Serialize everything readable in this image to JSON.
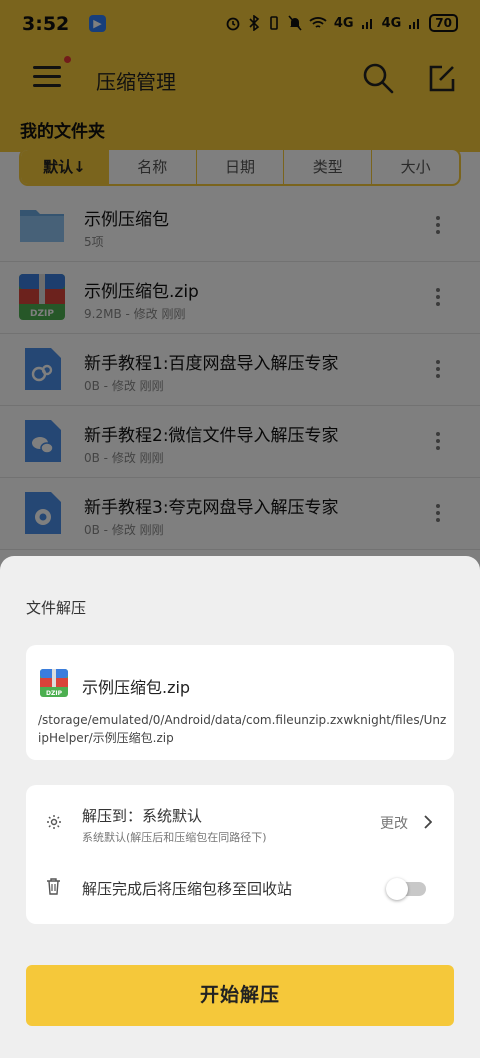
{
  "status_bar": {
    "time": "3:52",
    "app_badge": "▶",
    "network_1": "4G",
    "network_2": "4G",
    "battery": "70"
  },
  "app_bar": {
    "title": "压缩管理",
    "search_icon": "search-icon",
    "edit_icon": "edit-icon"
  },
  "section": {
    "title": "我的文件夹"
  },
  "sort_tabs": [
    {
      "label": "默认↓",
      "active": true
    },
    {
      "label": "名称",
      "active": false
    },
    {
      "label": "日期",
      "active": false
    },
    {
      "label": "类型",
      "active": false
    },
    {
      "label": "大小",
      "active": false
    }
  ],
  "files": [
    {
      "name": "示例压缩包",
      "meta": "5项",
      "icon": "folder-icon"
    },
    {
      "name": "示例压缩包.zip",
      "meta": "9.2MB - 修改 刚刚",
      "icon": "zip-archive-icon"
    },
    {
      "name": "新手教程1:百度网盘导入解压专家",
      "meta": "0B - 修改 刚刚",
      "icon": "baidu-doc-icon"
    },
    {
      "name": "新手教程2:微信文件导入解压专家",
      "meta": "0B - 修改 刚刚",
      "icon": "wechat-doc-icon"
    },
    {
      "name": "新手教程3:夸克网盘导入解压专家",
      "meta": "0B - 修改 刚刚",
      "icon": "quark-doc-icon"
    }
  ],
  "sheet": {
    "title": "文件解压",
    "file_name": "示例压缩包.zip",
    "file_path": "/storage/emulated/0/Android/data/com.fileunzip.zxwknight/files/UnzipHelper/示例压缩包.zip",
    "extract_to_label": "解压到：系统默认",
    "extract_to_sub": "系统默认(解压后和压缩包在同路径下)",
    "change_label": "更改",
    "recycle_label": "解压完成后将压缩包移至回收站",
    "recycle_toggle_on": false,
    "start_label": "开始解压"
  },
  "colors": {
    "accent": "#f5c83a",
    "zip_blue": "#3b7ddd",
    "zip_red": "#d9443a",
    "zip_green": "#4caf50"
  }
}
